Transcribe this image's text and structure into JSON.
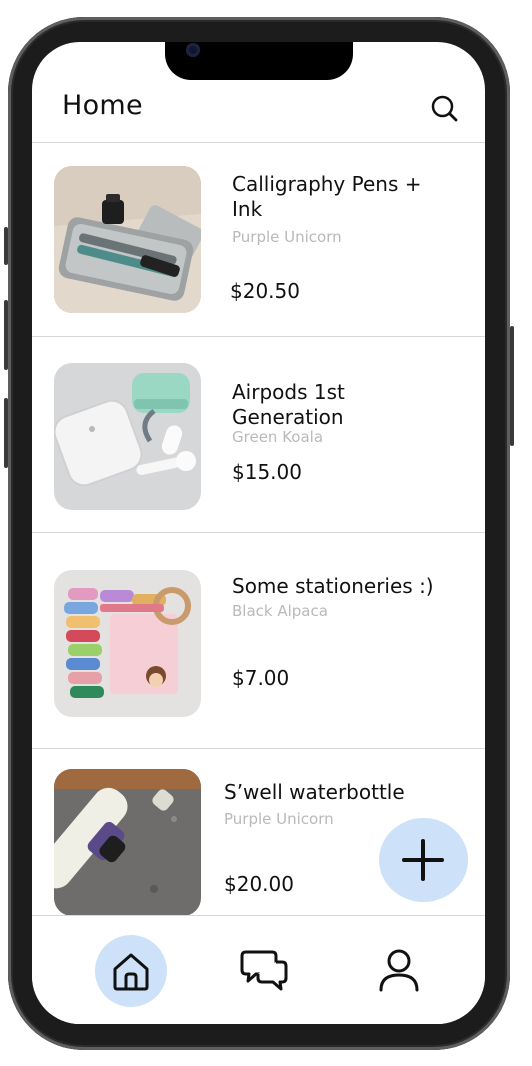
{
  "header": {
    "title": "Home",
    "search_icon": "search-icon"
  },
  "listings": [
    {
      "title": "Calligraphy Pens + Ink",
      "seller": "Purple Unicorn",
      "price": "$20.50"
    },
    {
      "title": "Airpods 1st Generation",
      "seller": "Green Koala",
      "price": "$15.00"
    },
    {
      "title": "Some stationeries :)",
      "seller": "Black Alpaca",
      "price": "$7.00"
    },
    {
      "title": "S’well waterbottle",
      "seller": "Purple Unicorn",
      "price": "$20.00"
    }
  ],
  "fab": {
    "icon": "plus-icon"
  },
  "tabbar": {
    "items": [
      {
        "icon": "home-icon",
        "active": true
      },
      {
        "icon": "chat-icon",
        "active": false
      },
      {
        "icon": "profile-icon",
        "active": false
      }
    ]
  },
  "colors": {
    "accent_light": "#cde1f8",
    "text": "#111111",
    "muted": "#b9b9b9",
    "divider": "#d8d8d8"
  }
}
